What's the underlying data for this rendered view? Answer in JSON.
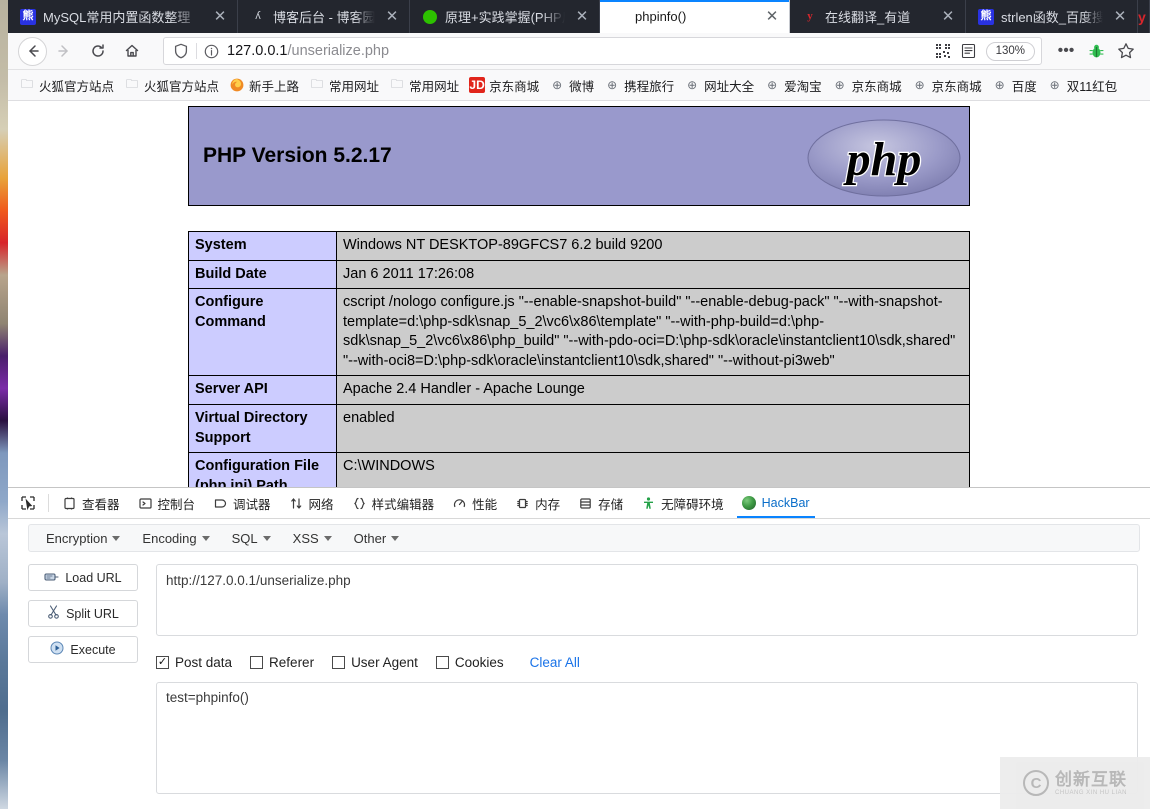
{
  "browser": {
    "tabs": [
      {
        "title": "MySQL常用内置函数整理",
        "favicon": "baidu-icon",
        "active": false
      },
      {
        "title": "博客后台 - 博客园",
        "favicon": "cnblogs-icon",
        "active": false
      },
      {
        "title": "原理+实践掌握(PHP反序列化)",
        "favicon": "wechat-icon",
        "active": false
      },
      {
        "title": "phpinfo()",
        "favicon": "none",
        "active": true
      },
      {
        "title": "在线翻译_有道",
        "favicon": "youdao-icon",
        "active": false
      },
      {
        "title": "strlen函数_百度搜索",
        "favicon": "baidu-icon",
        "active": false
      }
    ],
    "tab_close_label": "✕",
    "nav": {
      "back_label": "←",
      "forward_label": "→",
      "reload_label": "⟳",
      "home_label": "⌂"
    },
    "urlbar": {
      "host": "127.0.0.1",
      "path": "/unserialize.php",
      "zoom": "130%",
      "shield_icon": "shield-icon",
      "info_icon": "info-icon",
      "qr_icon": "qr-code-icon",
      "reader_icon": "reader-mode-icon",
      "menu_label": "•••",
      "debug_icon": "bug-icon",
      "bookmark_icon": "star-icon"
    },
    "bookmarks": [
      {
        "label": "火狐官方站点",
        "icon": "folder-icon"
      },
      {
        "label": "火狐官方站点",
        "icon": "folder-icon"
      },
      {
        "label": "新手上路",
        "icon": "firefox-icon"
      },
      {
        "label": "常用网址",
        "icon": "folder-icon"
      },
      {
        "label": "常用网址",
        "icon": "folder-icon"
      },
      {
        "label": "京东商城",
        "icon": "jd-icon"
      },
      {
        "label": "微博",
        "icon": "globe-icon"
      },
      {
        "label": "携程旅行",
        "icon": "globe-icon"
      },
      {
        "label": "网址大全",
        "icon": "globe-icon"
      },
      {
        "label": "爱淘宝",
        "icon": "globe-icon"
      },
      {
        "label": "京东商城",
        "icon": "globe-icon"
      },
      {
        "label": "京东商城",
        "icon": "globe-icon"
      },
      {
        "label": "百度",
        "icon": "globe-icon"
      },
      {
        "label": "双11红包",
        "icon": "globe-icon"
      }
    ]
  },
  "page": {
    "php_version": "PHP Version 5.2.17",
    "logo_text": "php",
    "rows": [
      {
        "key": "System",
        "value": "Windows NT DESKTOP-89GFCS7 6.2 build 9200"
      },
      {
        "key": "Build Date",
        "value": "Jan 6 2011 17:26:08"
      },
      {
        "key": "Configure Command",
        "value": "cscript /nologo configure.js \"--enable-snapshot-build\" \"--enable-debug-pack\" \"--with-snapshot-template=d:\\php-sdk\\snap_5_2\\vc6\\x86\\template\" \"--with-php-build=d:\\php-sdk\\snap_5_2\\vc6\\x86\\php_build\" \"--with-pdo-oci=D:\\php-sdk\\oracle\\instantclient10\\sdk,shared\" \"--with-oci8=D:\\php-sdk\\oracle\\instantclient10\\sdk,shared\" \"--without-pi3web\""
      },
      {
        "key": "Server API",
        "value": "Apache 2.4 Handler - Apache Lounge"
      },
      {
        "key": "Virtual Directory Support",
        "value": "enabled"
      },
      {
        "key": "Configuration File (php.ini) Path",
        "value": "C:\\WINDOWS"
      }
    ]
  },
  "devtools": {
    "picker_icon": "element-picker-icon",
    "tabs": [
      {
        "label": "查看器",
        "icon": "inspector-icon",
        "active": false
      },
      {
        "label": "控制台",
        "icon": "console-icon",
        "active": false
      },
      {
        "label": "调试器",
        "icon": "debugger-icon",
        "active": false
      },
      {
        "label": "网络",
        "icon": "network-icon",
        "active": false
      },
      {
        "label": "样式编辑器",
        "icon": "style-editor-icon",
        "active": false
      },
      {
        "label": "性能",
        "icon": "performance-icon",
        "active": false
      },
      {
        "label": "内存",
        "icon": "memory-icon",
        "active": false
      },
      {
        "label": "存储",
        "icon": "storage-icon",
        "active": false
      },
      {
        "label": "无障碍环境",
        "icon": "accessibility-icon",
        "active": false
      },
      {
        "label": "HackBar",
        "icon": "hackbar-icon",
        "active": true
      }
    ]
  },
  "hackbar": {
    "menu": [
      {
        "label": "Encryption"
      },
      {
        "label": "Encoding"
      },
      {
        "label": "SQL"
      },
      {
        "label": "XSS"
      },
      {
        "label": "Other"
      }
    ],
    "buttons": [
      {
        "label": "Load URL",
        "icon": "load-url-icon"
      },
      {
        "label": "Split URL",
        "icon": "scissors-icon"
      },
      {
        "label": "Execute",
        "icon": "play-icon"
      }
    ],
    "url_value": "http://127.0.0.1/unserialize.php",
    "url_placeholder": "",
    "checkboxes": [
      {
        "label": "Post data",
        "checked": true
      },
      {
        "label": "Referer",
        "checked": false
      },
      {
        "label": "User Agent",
        "checked": false
      },
      {
        "label": "Cookies",
        "checked": false
      }
    ],
    "clear_all_label": "Clear All",
    "post_value": "test=phpinfo()",
    "post_placeholder": ""
  },
  "watermark": {
    "mark": "C",
    "cn": "创新互联",
    "en": "CHUANG XIN HU LIAN"
  },
  "colors": {
    "tabbar_bg": "#23262e",
    "accent": "#0a84ff",
    "php_header": "#9999cc",
    "php_key": "#ccccff",
    "php_value": "#cccccc",
    "link": "#1a73e8"
  }
}
